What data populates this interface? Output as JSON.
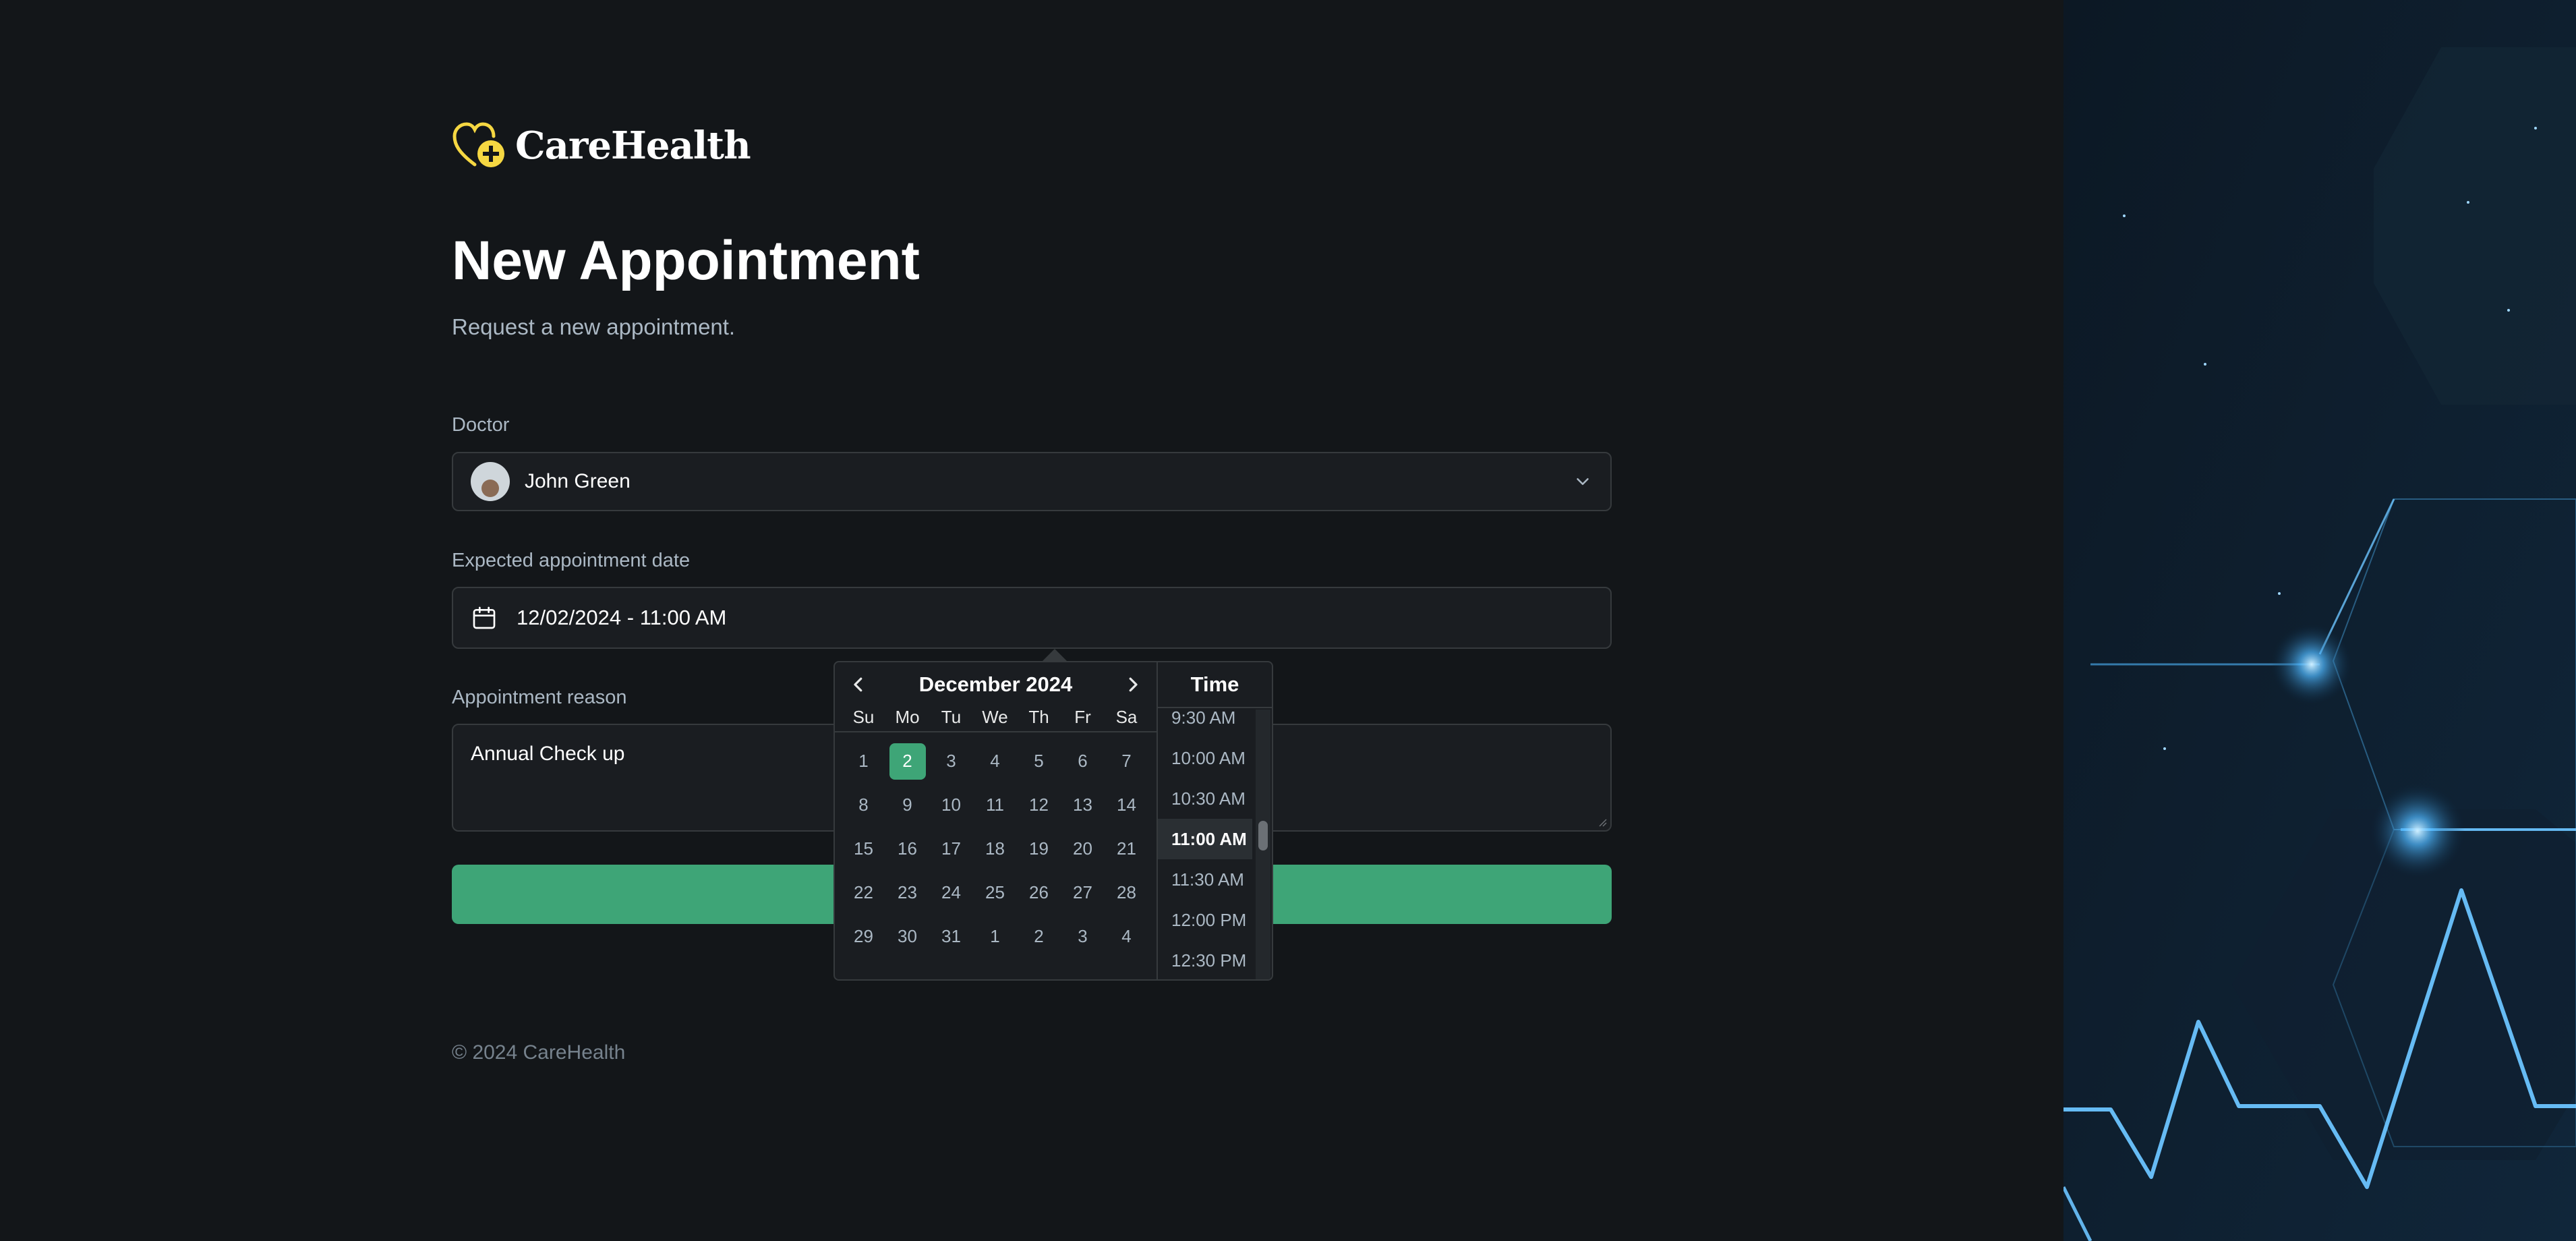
{
  "brand": {
    "name": "CareHealth"
  },
  "header": {
    "title": "New Appointment",
    "subtitle": "Request a new appointment."
  },
  "form": {
    "doctor": {
      "label": "Doctor",
      "value": "John Green"
    },
    "date": {
      "label": "Expected appointment date",
      "value": "12/02/2024 - 11:00 AM"
    },
    "reason": {
      "label": "Appointment reason",
      "value": "Annual Check up"
    }
  },
  "datepicker": {
    "month_label": "December 2024",
    "time_header": "Time",
    "weekdays": [
      "Su",
      "Mo",
      "Tu",
      "We",
      "Th",
      "Fr",
      "Sa"
    ],
    "weeks": [
      [
        "1",
        "2",
        "3",
        "4",
        "5",
        "6",
        "7"
      ],
      [
        "8",
        "9",
        "10",
        "11",
        "12",
        "13",
        "14"
      ],
      [
        "15",
        "16",
        "17",
        "18",
        "19",
        "20",
        "21"
      ],
      [
        "22",
        "23",
        "24",
        "25",
        "26",
        "27",
        "28"
      ],
      [
        "29",
        "30",
        "31",
        "1",
        "2",
        "3",
        "4"
      ]
    ],
    "selected_day": "2",
    "times": [
      "9:30 AM",
      "10:00 AM",
      "10:30 AM",
      "11:00 AM",
      "11:30 AM",
      "12:00 PM",
      "12:30 PM"
    ],
    "selected_time": "11:00 AM"
  },
  "footer": {
    "copyright": "© 2024 CareHealth"
  },
  "colors": {
    "accent": "#3ea577",
    "background": "#131619",
    "logo_yellow": "#f5d742"
  }
}
